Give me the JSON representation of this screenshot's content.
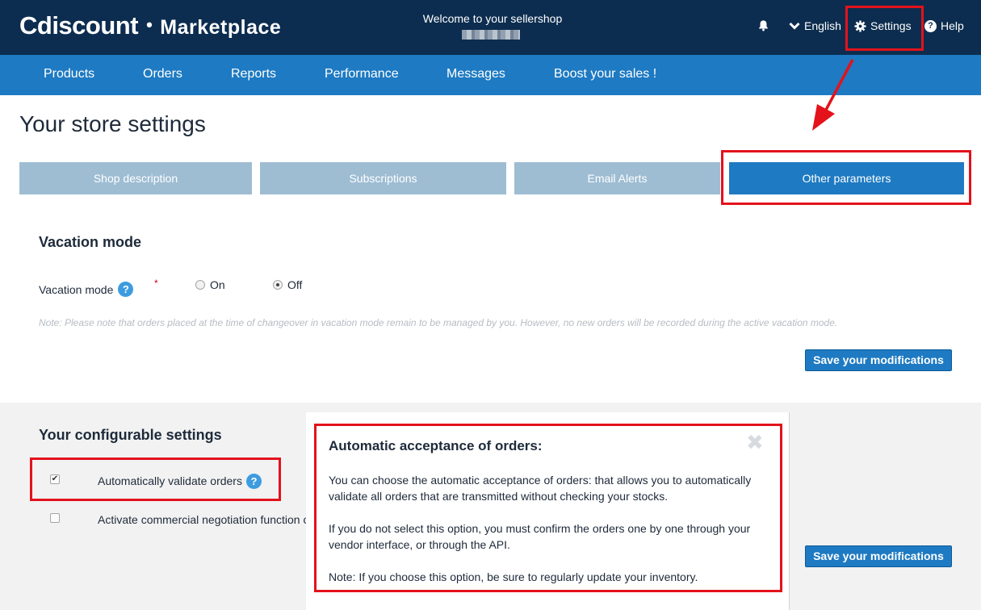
{
  "header": {
    "logo_brand": "Cdiscount",
    "logo_dot": "•",
    "logo_suffix": "Marketplace",
    "welcome": "Welcome to your sellershop",
    "language": "English",
    "settings": "Settings",
    "help": "Help",
    "icons": {
      "bell": "bell-icon",
      "chevron": "chevron-down-icon",
      "gear": "gear-icon",
      "help": "help-icon"
    }
  },
  "nav": {
    "items": [
      "Products",
      "Orders",
      "Reports",
      "Performance",
      "Messages",
      "Boost your sales !"
    ]
  },
  "page": {
    "title": "Your store settings"
  },
  "tabs": [
    {
      "label": "Shop description",
      "active": false
    },
    {
      "label": "Subscriptions",
      "active": false
    },
    {
      "label": "Email Alerts",
      "active": false
    },
    {
      "label": "Other parameters",
      "active": true
    }
  ],
  "vacation": {
    "title": "Vacation mode",
    "label": "Vacation mode",
    "required_mark": "*",
    "options": [
      {
        "label": "On",
        "checked": false
      },
      {
        "label": "Off",
        "checked": true
      }
    ],
    "note": "Note: Please note that orders placed at the time of changeover in vacation mode remain to be managed by you. However, no new orders will be recorded during the active vacation mode.",
    "save_label": "Save your modifications"
  },
  "configurable": {
    "title": "Your configurable settings",
    "items": [
      {
        "label": "Automatically validate orders",
        "checked": true
      },
      {
        "label": "Activate commercial negotiation function o",
        "checked": false
      }
    ],
    "save_label": "Save your modifications"
  },
  "popup": {
    "title": "Automatic acceptance of orders:",
    "close_glyph": "✖",
    "paragraphs": [
      "You can choose the automatic acceptance of orders: that allows you to automatically validate all orders that are transmitted without checking your stocks.",
      "If you do not select this option, you must confirm the orders one by one through your vendor interface, or through the API.",
      "Note: If you choose this option, be sure to regularly update your inventory."
    ]
  },
  "colors": {
    "topbar": "#0c2d4f",
    "nav": "#1e7ac2",
    "tab_inactive": "#9ebdd3",
    "annotation_red": "#e3121b"
  }
}
